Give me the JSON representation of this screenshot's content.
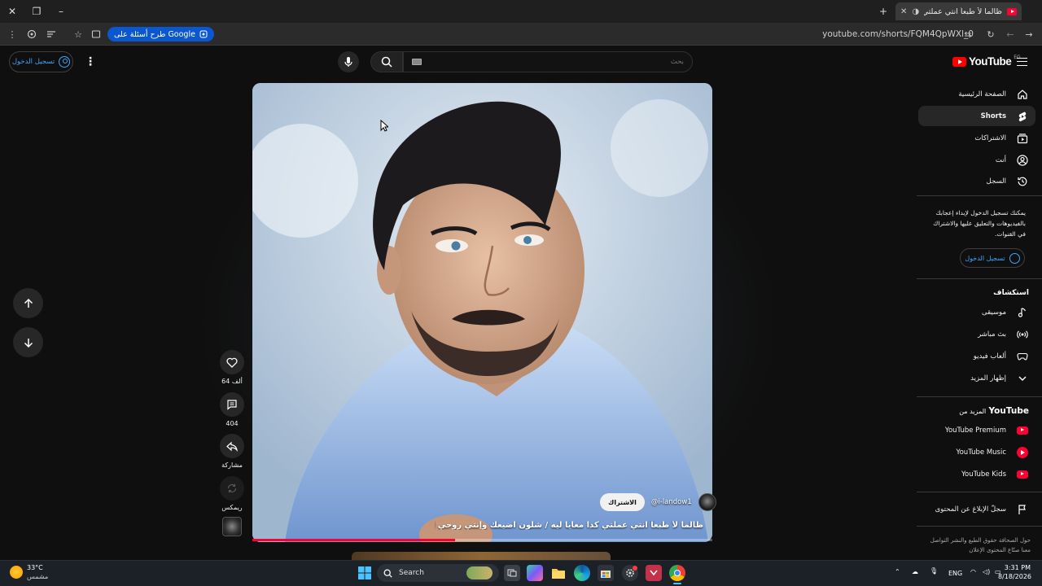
{
  "browser": {
    "tab_title": "ظالما لأ طبعاً انتي عملتي كدا",
    "url": "youtube.com/shorts/FQM4QpWXl_0",
    "google_pill": "طرح أسئلة على Google"
  },
  "header": {
    "signin_label": "تسجيل الدخول",
    "search_placeholder": "بحث",
    "logo_text": "YouTube",
    "country_code": "EG"
  },
  "sidebar": {
    "items": [
      {
        "label": "الصفحة الرئيسية",
        "icon": "home-icon"
      },
      {
        "label": "Shorts",
        "icon": "shorts-icon"
      },
      {
        "label": "الاشتراكات",
        "icon": "subscriptions-icon"
      },
      {
        "label": "أنت",
        "icon": "you-icon"
      },
      {
        "label": "السجل",
        "icon": "history-icon"
      }
    ],
    "signin_prompt": "يمكنك تسجيل الدخول لإبداء إعجابك بالفيديوهات والتعليق عليها والاشتراك في القنوات.",
    "signin_label": "تسجيل الدخول",
    "explore_title": "استكشاف",
    "explore": [
      {
        "label": "موسيقى",
        "icon": "music-note-icon"
      },
      {
        "label": "بث مباشر",
        "icon": "live-icon"
      },
      {
        "label": "ألعاب فيديو",
        "icon": "gaming-icon"
      },
      {
        "label": "إظهار المزيد",
        "icon": "chevron-down-icon"
      }
    ],
    "more_title_prefix": "المزيد من",
    "more_title_brand": "YouTube",
    "more": [
      {
        "label": "YouTube Premium"
      },
      {
        "label": "YouTube Music"
      },
      {
        "label": "YouTube Kids"
      }
    ],
    "report_label": "سجلّ الإبلاغ عن المحتوى",
    "footer": "حول  الصحافة  حقوق الطبع والنشر  التواصل معنا  صنّاع المحتوى  الإعلان"
  },
  "short": {
    "likes": "64 ألف",
    "comments": "404",
    "share_label": "مشاركة",
    "remix_label": "ريمكس",
    "channel_handle": "@i-landow1",
    "subscribe_label": "الاشتراك",
    "caption": "ظالما لأ طبعاً انتي عملتي كدا معايا ليه / شلون اضيعك وإنتي روحي القاها...",
    "progress": 0.44
  },
  "taskbar": {
    "weather_temp": "33°C",
    "weather_desc": "مشمس",
    "search_label": "Search",
    "lang": "ENG",
    "time": "3:31 PM",
    "date": "8/18/2026"
  }
}
